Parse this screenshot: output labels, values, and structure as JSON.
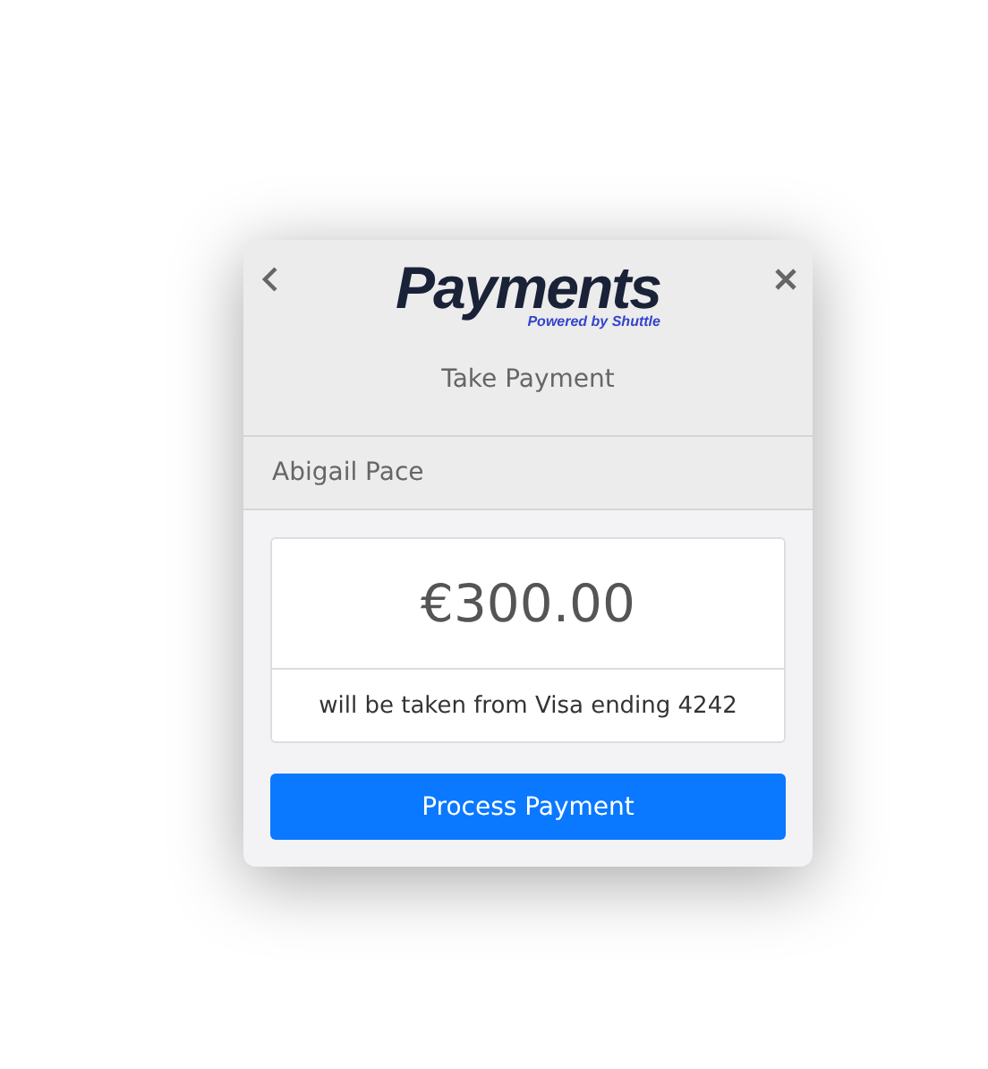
{
  "header": {
    "logo": {
      "title": "Payments",
      "subtitle": "Powered by Shuttle"
    },
    "title": "Take Payment"
  },
  "customer": {
    "name": "Abigail Pace"
  },
  "payment": {
    "amount": "€300.00",
    "source": "will be taken from Visa ending 4242"
  },
  "buttons": [
    {
      "label": "Process Payment",
      "kind": "primary"
    }
  ]
}
